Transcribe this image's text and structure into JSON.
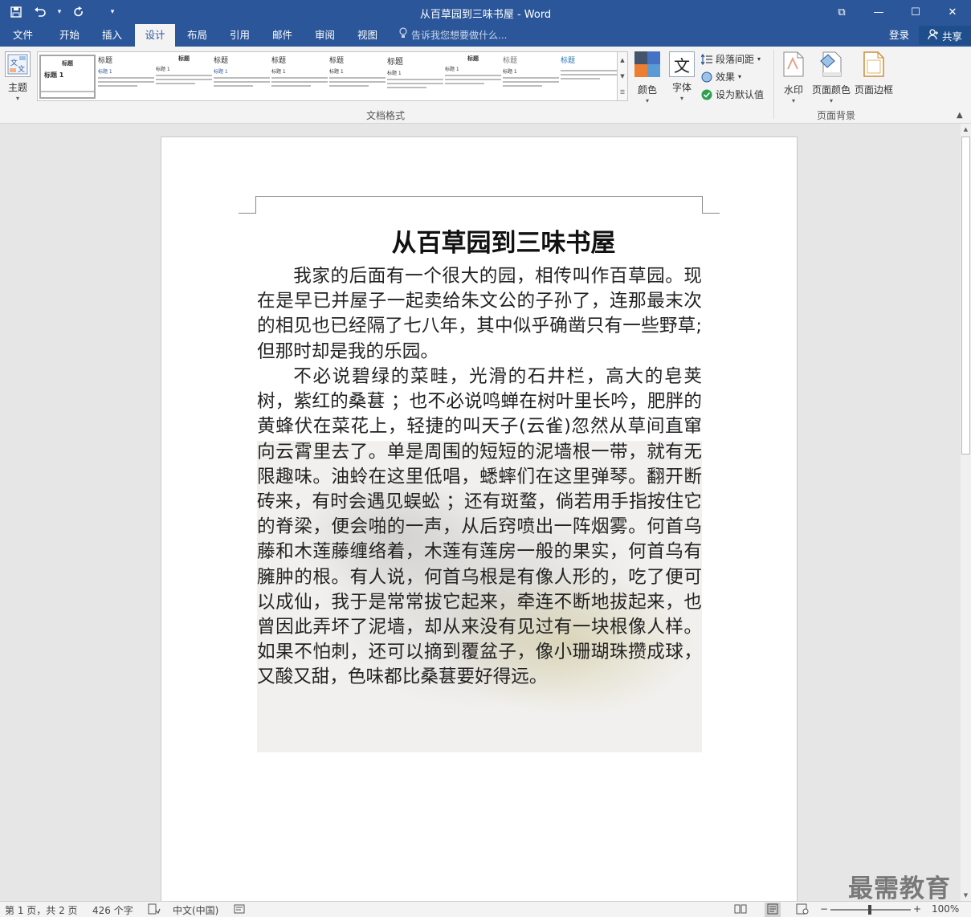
{
  "window": {
    "title": "从百草园到三味书屋 - Word",
    "qat": {
      "save_icon": "save-icon",
      "undo_icon": "undo-icon",
      "redo_icon": "redo-icon"
    },
    "restore_label": "❐",
    "minimize_label": "—",
    "maximize_label": "☐",
    "close_label": "✕",
    "ribbon_display_label": "⧉"
  },
  "tabs": [
    {
      "label": "文件"
    },
    {
      "label": "开始"
    },
    {
      "label": "插入"
    },
    {
      "label": "设计"
    },
    {
      "label": "布局"
    },
    {
      "label": "引用"
    },
    {
      "label": "邮件"
    },
    {
      "label": "审阅"
    },
    {
      "label": "视图"
    }
  ],
  "tell_me": "告诉我您想要做什么...",
  "sign_in": "登录",
  "share": "共享",
  "ribbon": {
    "theme_label": "主题",
    "gallery_title_label": "标题",
    "gallery_title1_label": "标题 1",
    "colors_label": "颜色",
    "fonts_label": "字体",
    "paragraph_spacing_label": "段落间距",
    "effects_label": "效果",
    "set_default_label": "设为默认值",
    "doc_format_group": "文档格式",
    "watermark_label": "水印",
    "page_color_label": "页面颜色",
    "page_border_label": "页面边框",
    "page_bg_group": "页面背景"
  },
  "document": {
    "title": "从百草园到三味书屋",
    "paragraphs": [
      "我家的后面有一个很大的园，相传叫作百草园。现在是早已并屋子一起卖给朱文公的子孙了，连那最末次的相见也已经隔了七八年，其中似乎确凿只有一些野草;但那时却是我的乐园。",
      "不必说碧绿的菜畦，光滑的石井栏，高大的皂荚树，紫红的桑葚 ；也不必说鸣蝉在树叶里长吟，肥胖的黄蜂伏在菜花上，轻捷的叫天子(云雀)忽然从草间直窜向云霄里去了。单是周围的短短的泥墙根一带，就有无限趣味。油蛉在这里低唱，蟋蟀们在这里弹琴。翻开断砖来，有时会遇见蜈蚣 ；还有斑蝥，倘若用手指按住它的脊梁，便会啪的一声，从后窍喷出一阵烟雾。何首乌藤和木莲藤缠络着，木莲有莲房一般的果实，何首乌有臃肿的根。有人说，何首乌根是有像人形的，吃了便可以成仙，我于是常常拔它起来，牵连不断地拔起来，也曾因此弄坏了泥墙，却从来没有见过有一块根像人样。如果不怕刺，还可以摘到覆盆子，像小珊瑚珠攒成球，又酸又甜，色味都比桑葚要好得远。"
    ]
  },
  "watermark_text": "最需教育",
  "status": {
    "page": "第 1 页，共 2 页",
    "words": "426 个字",
    "language": "中文(中国)",
    "zoom": "100%",
    "zoom_minus": "−",
    "zoom_plus": "+"
  },
  "colors": {
    "accent": "#2b579a",
    "ribbon_bg": "#f3f3f3",
    "page_bg": "#ffffff",
    "canvas_bg": "#e6e6e6"
  }
}
